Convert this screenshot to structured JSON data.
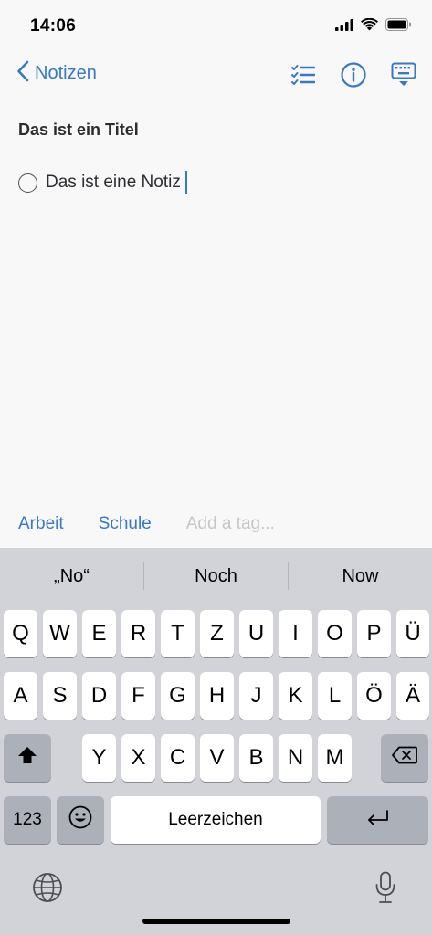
{
  "status_bar": {
    "time": "14:06"
  },
  "nav": {
    "back_label": "Notizen",
    "icons": [
      "checklist-icon",
      "info-icon",
      "keyboard-dismiss-icon"
    ]
  },
  "note": {
    "title": "Das ist ein Titel",
    "todo_text": "Das ist eine Notiz"
  },
  "tags": {
    "items": [
      "Arbeit",
      "Schule"
    ],
    "placeholder": "Add a tag..."
  },
  "keyboard": {
    "suggestions": [
      "„No“",
      "Noch",
      "Now"
    ],
    "row1": [
      "Q",
      "W",
      "E",
      "R",
      "T",
      "Z",
      "U",
      "I",
      "O",
      "P",
      "Ü"
    ],
    "row2": [
      "A",
      "S",
      "D",
      "F",
      "G",
      "H",
      "J",
      "K",
      "L",
      "Ö",
      "Ä"
    ],
    "row3": [
      "Y",
      "X",
      "C",
      "V",
      "B",
      "N",
      "M"
    ],
    "numbers_label": "123",
    "space_label": "Leerzeichen"
  },
  "colors": {
    "accent": "#3a78c1",
    "background": "#f8f8f9",
    "keyboard_bg": "#d1d3d9",
    "key_dark": "#acb0b9"
  }
}
